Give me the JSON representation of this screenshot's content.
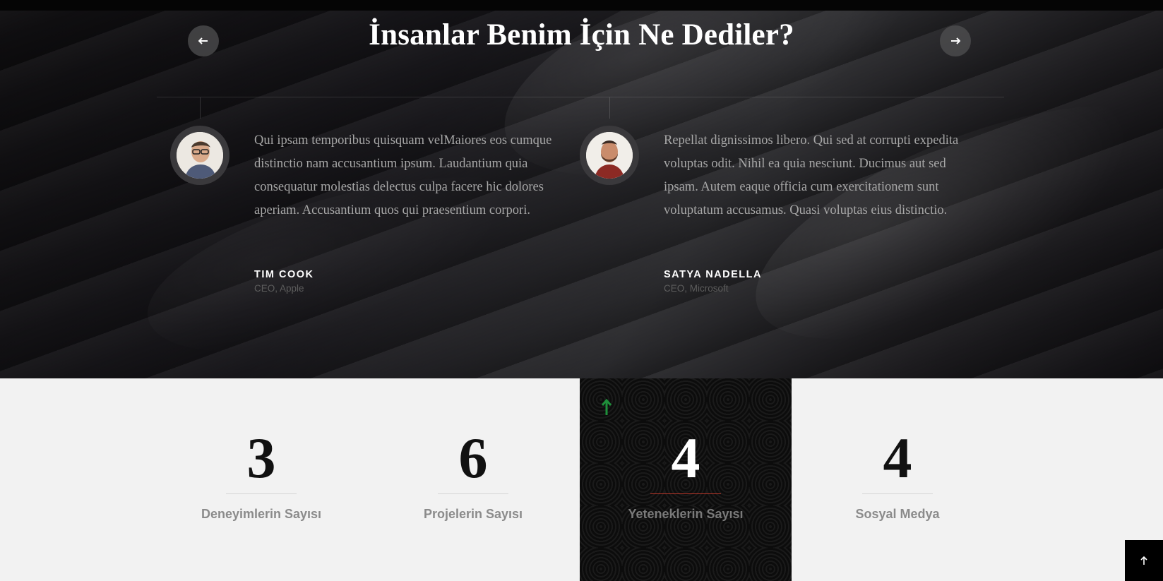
{
  "testimonials": {
    "title": "İnsanlar Benim İçin Ne Dediler?",
    "prev_icon": "arrow-left-icon",
    "next_icon": "arrow-right-icon",
    "items": [
      {
        "quote": "Qui ipsam temporibus quisquam velMaiores eos cumque distinctio nam accusantium ipsum. Laudantium quia consequatur molestias delectus culpa facere hic dolores aperiam. Accusantium quos qui praesentium corpori.",
        "name": "TIM COOK",
        "role": "CEO, Apple",
        "avatar": "person-avatar"
      },
      {
        "quote": "Repellat dignissimos libero. Qui sed at corrupti expedita voluptas odit. Nihil ea quia nesciunt. Ducimus aut sed ipsam. Autem eaque officia cum exercitationem sunt voluptatum accusamus. Quasi voluptas eius distinctio.",
        "name": "SATYA NADELLA",
        "role": "CEO, Microsoft",
        "avatar": "person-avatar"
      }
    ]
  },
  "stats": [
    {
      "value": "3",
      "label": "Deneyimlerin Sayısı"
    },
    {
      "value": "6",
      "label": "Projelerin Sayısı"
    },
    {
      "value": "4",
      "label": "Yeteneklerin Sayısı"
    },
    {
      "value": "4",
      "label": "Sosyal Medya"
    }
  ],
  "colors": {
    "accent_red": "#c0392b",
    "arrow_green": "#1e8f3a",
    "dark_bg": "#0d0d0d"
  },
  "scroll_top_icon": "arrow-up-icon"
}
